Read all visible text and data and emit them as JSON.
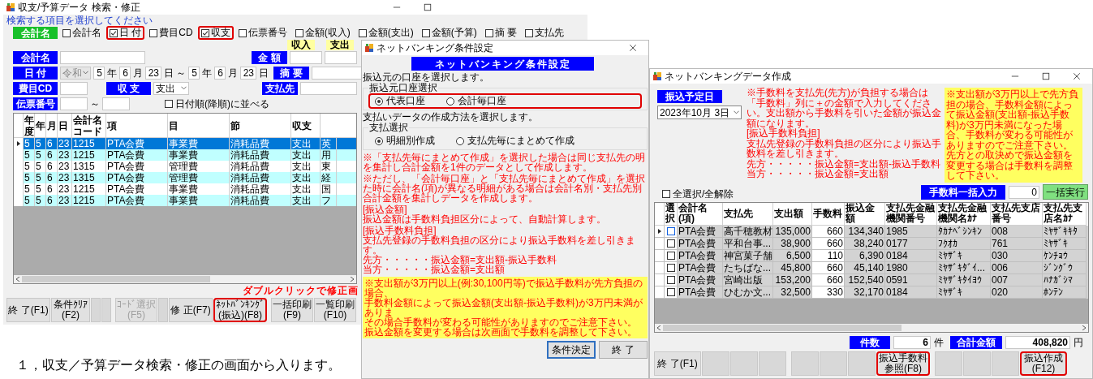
{
  "search_window": {
    "title": "収支/予算データ 検索・修正",
    "title_buttons": [
      {
        "kind": "minimize"
      },
      {
        "kind": "maximize"
      }
    ],
    "prompt": "検索する項目を選択してください",
    "filter_label": "会計名",
    "filters": [
      {
        "label": "会計名",
        "checked": false,
        "highlighted": false
      },
      {
        "label": "日 付",
        "checked": true,
        "highlighted": true
      },
      {
        "label": "費目CD",
        "checked": false,
        "highlighted": false
      },
      {
        "label": "収支",
        "checked": true,
        "highlighted": true
      },
      {
        "label": "伝票番号",
        "checked": false,
        "highlighted": false
      },
      {
        "label": "金額(収入)",
        "checked": false,
        "highlighted": false
      },
      {
        "label": "金額(支出)",
        "checked": false,
        "highlighted": false
      },
      {
        "label": "金額(予算)",
        "checked": false,
        "highlighted": false
      },
      {
        "label": "摘 要",
        "checked": false,
        "highlighted": false
      },
      {
        "label": "支払先",
        "checked": false,
        "highlighted": false
      }
    ],
    "amount_headers": [
      "収入",
      "支出"
    ],
    "form": {
      "account_label": "会計名",
      "amount_label": "金 額",
      "date_label": "日 付",
      "era": {
        "value": "令和",
        "disabled": true
      },
      "date_from": [
        {
          "value": "5",
          "unit": "年"
        },
        {
          "value": "6",
          "unit": "月"
        },
        {
          "value": "23",
          "unit": "日"
        }
      ],
      "range_mark": "～",
      "date_to": [
        {
          "value": "5",
          "unit": "年"
        },
        {
          "value": "6",
          "unit": "月"
        },
        {
          "value": "23",
          "unit": "日"
        }
      ],
      "summary_label": "摘 要",
      "expense_label": "費目CD",
      "type_label": "収 支",
      "type_value": "支出",
      "payee_label": "支払先",
      "slip_label": "伝票番号",
      "slip_range_mark": "～",
      "sort_option": {
        "label": "日付順(降順)に並べる",
        "checked": false
      }
    },
    "table": {
      "columns": [
        "年度",
        "年",
        "月",
        "日",
        "会計名コード",
        "項",
        "目",
        "節",
        "収支"
      ],
      "rows": [
        {
          "selected": true,
          "cells": [
            "5",
            "5",
            "6",
            "23",
            "1215",
            "PTA会費",
            "事業費",
            "消耗品費",
            "支出",
            "英"
          ]
        },
        {
          "selected": false,
          "cells": [
            "5",
            "5",
            "6",
            "23",
            "1215",
            "PTA会費",
            "事業費",
            "消耗品費",
            "支出",
            "用"
          ]
        },
        {
          "selected": false,
          "cells": [
            "5",
            "5",
            "6",
            "23",
            "1315",
            "PTA会費",
            "管理費",
            "消耗品費",
            "支出",
            "東"
          ]
        },
        {
          "selected": false,
          "cells": [
            "5",
            "5",
            "6",
            "23",
            "1315",
            "PTA会費",
            "管理費",
            "消耗品費",
            "支出",
            "経"
          ]
        },
        {
          "selected": false,
          "cells": [
            "5",
            "5",
            "6",
            "23",
            "1215",
            "PTA会費",
            "事業費",
            "消耗品費",
            "支出",
            "国"
          ]
        },
        {
          "selected": false,
          "cells": [
            "5",
            "5",
            "6",
            "23",
            "1215",
            "PTA会費",
            "事業費",
            "消耗品費",
            "支出",
            "フ"
          ]
        }
      ]
    },
    "hint": "ダブルクリックで修正画",
    "button_groups": [
      [
        {
          "kind": "key",
          "label": "終 了(F1)",
          "disabled": false,
          "highlighted": false
        },
        {
          "kind": "key",
          "label": "条件ｸﾘｱ\n(F2)",
          "disabled": false,
          "highlighted": false
        },
        {
          "kind": "blank"
        },
        {
          "kind": "blank"
        }
      ],
      [
        {
          "kind": "key",
          "label": "ｺｰﾄﾞ選択\n(F5)",
          "disabled": true,
          "highlighted": false
        },
        {
          "kind": "blank"
        },
        {
          "kind": "key",
          "label": "修 正(F7)",
          "disabled": false,
          "highlighted": false
        },
        {
          "kind": "key",
          "label": "ﾈｯﾄﾊﾞﾝｷﾝｸﾞ\n(振込)(F8)",
          "disabled": false,
          "highlighted": true
        }
      ],
      [
        {
          "kind": "key",
          "label": "一括印刷\n(F9)",
          "disabled": false,
          "highlighted": false
        },
        {
          "kind": "key",
          "label": "一覧印刷\n(F10)",
          "disabled": false,
          "highlighted": false
        }
      ]
    ]
  },
  "condition_dialog": {
    "title": "ネットバンキング条件設定",
    "title_buttons": [
      {
        "kind": "close"
      }
    ],
    "heading": "ネットバンキング条件設定",
    "sections": [
      {
        "prompt": "振込元の口座を選択します。",
        "group_label": "振込元口座選択",
        "highlighted": true,
        "options": [
          {
            "label": "代表口座",
            "selected": true
          },
          {
            "label": "会計毎口座",
            "selected": false
          }
        ]
      },
      {
        "prompt": "支払いデータの作成方法を選択します。",
        "group_label": "支払選択",
        "highlighted": false,
        "options": [
          {
            "label": "明細別作成",
            "selected": true
          },
          {
            "label": "支払先毎にまとめて作成",
            "selected": false
          }
        ]
      }
    ],
    "notes": [
      [
        "※「支払先毎にまとめて作成」を選択した場合は同じ支払先の明",
        "を集計し合計金額を1件のデータとして作成します。"
      ],
      [
        "※ただし、「会計毎口座」と「支払先毎にまとめて作成」を選択",
        "た時に会計名(項)が異なる明細がある場合は会計名別・支払先別",
        "合計金額を集計しデータを作成します。"
      ],
      [
        "[振込金額]",
        "振込金額は手数料負担区分によって、自動計算します。"
      ],
      [
        "[振込手数料負担]",
        "支払先登録の手数料負担の区分により振込手数料を差し引きます。",
        "先方・・・・・振込金額=支出額-振込手数料",
        "当方・・・・・振込金額=支出額"
      ]
    ],
    "warning_lines": [
      "※支出額が3万円以上(例:30,100円等)で振込手数料が先方負担の場合、",
      "手数料金額によって振込金額(支出額-振込手数料)が3万円未満がありま",
      "その場合手数料が変わる可能性がありますのでご注意下さい。",
      "振込金額を変更する場合は次画面で手数料を調整して下さい。"
    ],
    "buttons": [
      {
        "label": "条件決定",
        "default": true
      },
      {
        "label": "終 了",
        "default": false
      }
    ]
  },
  "data_window": {
    "title": "ネットバンキングデータ作成",
    "title_buttons": [
      {
        "kind": "minimize"
      },
      {
        "kind": "maximize"
      },
      {
        "kind": "close"
      }
    ],
    "date_label": "振込予定日",
    "date_value": "2023年10月 3日",
    "notes": [
      "※手数料を支払先(先方)が負担する場合は「手数料」列に＋の金額で入力してください。支出額から手数料を引いた金額が振込金額になります。",
      "[振込手数料負担]",
      "支払先登録の手数料負担の区分により振込手数料を差し引きます。",
      "先方・・・・・振込金額=支出額-振込手数料",
      "当方・・・・・振込金額=支出額"
    ],
    "warning": "※支出額が3万円以上で先方負担の場合、手数料金額によって振込金額(支出額-振込手数料)が3万円未満になった場合、手数料が変わる可能性がありますのでご注意下さい。先方との取決めで振込金額を変更する場合は手数料を調整して下さい。",
    "select_all": {
      "label": "全選択/全解除",
      "checked": false
    },
    "fee_label": "手数料一括入力",
    "fee_value": "0",
    "apply_button": "一括実行",
    "table": {
      "columns": [
        "選択",
        "会計名(項)",
        "支払先",
        "支出額",
        "手数料",
        "振込金額",
        "支払先金融機関番号",
        "支払先金融機関名ｶﾅ",
        "支払先支店番号",
        "支払先支店名ｶﾅ"
      ],
      "rows": [
        {
          "selected": true,
          "checked": false,
          "cells": [
            "",
            "PTA会費",
            "高千穂教材",
            "135,000",
            "660",
            "134,340",
            "1985",
            "ﾀｶﾅﾍﾞｼﾝｷﾝ",
            "008",
            "ﾐﾔｻﾞｷｷﾀ"
          ]
        },
        {
          "selected": false,
          "checked": false,
          "cells": [
            "",
            "PTA会費",
            "平和台事...",
            "38,900",
            "660",
            "38,240",
            "0177",
            "ﾌｸｵｶ",
            "761",
            "ﾐﾔｻﾞｷ"
          ]
        },
        {
          "selected": false,
          "checked": false,
          "cells": [
            "",
            "PTA会費",
            "神宮菓子舗",
            "6,500",
            "110",
            "6,390",
            "0184",
            "ﾐﾔｻﾞｷ",
            "030",
            "ｹﾝﾁｮｳ"
          ]
        },
        {
          "selected": false,
          "checked": false,
          "cells": [
            "",
            "PTA会費",
            "たちばな...",
            "45,800",
            "660",
            "45,140",
            "1980",
            "ﾐﾔｻﾞｷﾀﾞｲ...",
            "006",
            "ｼﾞﾝｸﾞｳ"
          ]
        },
        {
          "selected": false,
          "checked": false,
          "cells": [
            "",
            "PTA会費",
            "宮崎出版",
            "153,200",
            "660",
            "152,540",
            "0591",
            "ﾐﾔｻﾞｷﾀｲﾖｳ",
            "007",
            "ﾊﾅｶﾞｼﾏ"
          ]
        },
        {
          "selected": false,
          "checked": false,
          "cells": [
            "",
            "PTA会費",
            "ひむか文...",
            "32,500",
            "330",
            "32,170",
            "0184",
            "ﾐﾔｻﾞｷ",
            "020",
            "ﾎﾝﾃﾝ"
          ]
        }
      ]
    },
    "count_label": "件数",
    "count_value": "6",
    "count_unit": "件",
    "total_label": "合計金額",
    "total_value": "408,820",
    "total_unit": "円",
    "button_groups": [
      [
        {
          "kind": "key",
          "label": "終 了(F1)",
          "highlighted": false
        },
        {
          "kind": "blank"
        },
        {
          "kind": "blank"
        },
        {
          "kind": "blank"
        }
      ],
      [
        {
          "kind": "blank"
        },
        {
          "kind": "blank"
        },
        {
          "kind": "blank"
        },
        {
          "kind": "key",
          "label": "振込手数料参照(F8)",
          "highlighted": true
        }
      ],
      [
        {
          "kind": "blank"
        },
        {
          "kind": "blank"
        },
        {
          "kind": "blank"
        },
        {
          "kind": "key",
          "label": "振込作成\n(F12)",
          "highlighted": true
        }
      ]
    ]
  },
  "caption": "１，収支／予算データ検索・修正の画面から入ります。"
}
